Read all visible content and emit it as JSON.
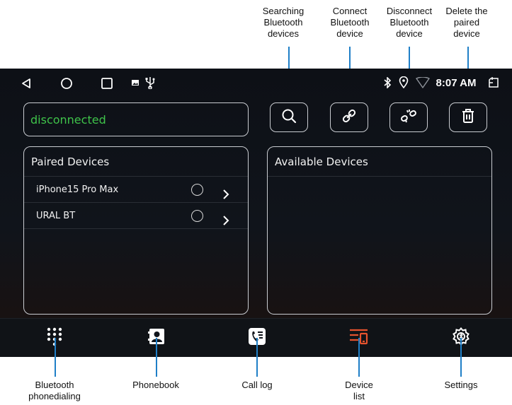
{
  "callouts_top": [
    {
      "lines": [
        "Searching",
        "Bluetooth",
        "devices"
      ]
    },
    {
      "lines": [
        "Connect",
        "Bluetooth",
        "device"
      ]
    },
    {
      "lines": [
        "Disconnect",
        "Bluetooth",
        "device"
      ]
    },
    {
      "lines": [
        "Delete the",
        "paired",
        "device"
      ]
    }
  ],
  "callouts_bottom": [
    {
      "lines": [
        "Bluetooth",
        "phonedialing"
      ]
    },
    {
      "lines": [
        "Phonebook"
      ]
    },
    {
      "lines": [
        "Call log"
      ]
    },
    {
      "lines": [
        "Device",
        "list"
      ]
    },
    {
      "lines": [
        "Settings"
      ]
    }
  ],
  "status_bar": {
    "time": "8:07 AM",
    "icons": [
      "back-icon",
      "home-icon",
      "recents-icon",
      "image-icon",
      "usb-icon",
      "bluetooth-icon",
      "location-icon",
      "wifi-icon",
      "screenshot-icon"
    ]
  },
  "connection_status": "disconnected",
  "toolbar": {
    "buttons": [
      "search-icon",
      "link-icon",
      "unlink-icon",
      "trash-icon"
    ]
  },
  "paired_panel": {
    "title": "Paired Devices",
    "devices": [
      {
        "name": "iPhone15 Pro Max"
      },
      {
        "name": "URAL BT"
      }
    ]
  },
  "available_panel": {
    "title": "Available Devices",
    "devices": []
  },
  "nav": {
    "items": [
      "dialpad-icon",
      "contacts-icon",
      "call-log-icon",
      "device-list-icon",
      "settings-icon"
    ],
    "active_index": 3
  },
  "colors": {
    "status_green": "#3fc34a",
    "active_nav": "#e5532e",
    "callout_line": "#1f7fc7",
    "border": "#c9ccd1"
  }
}
